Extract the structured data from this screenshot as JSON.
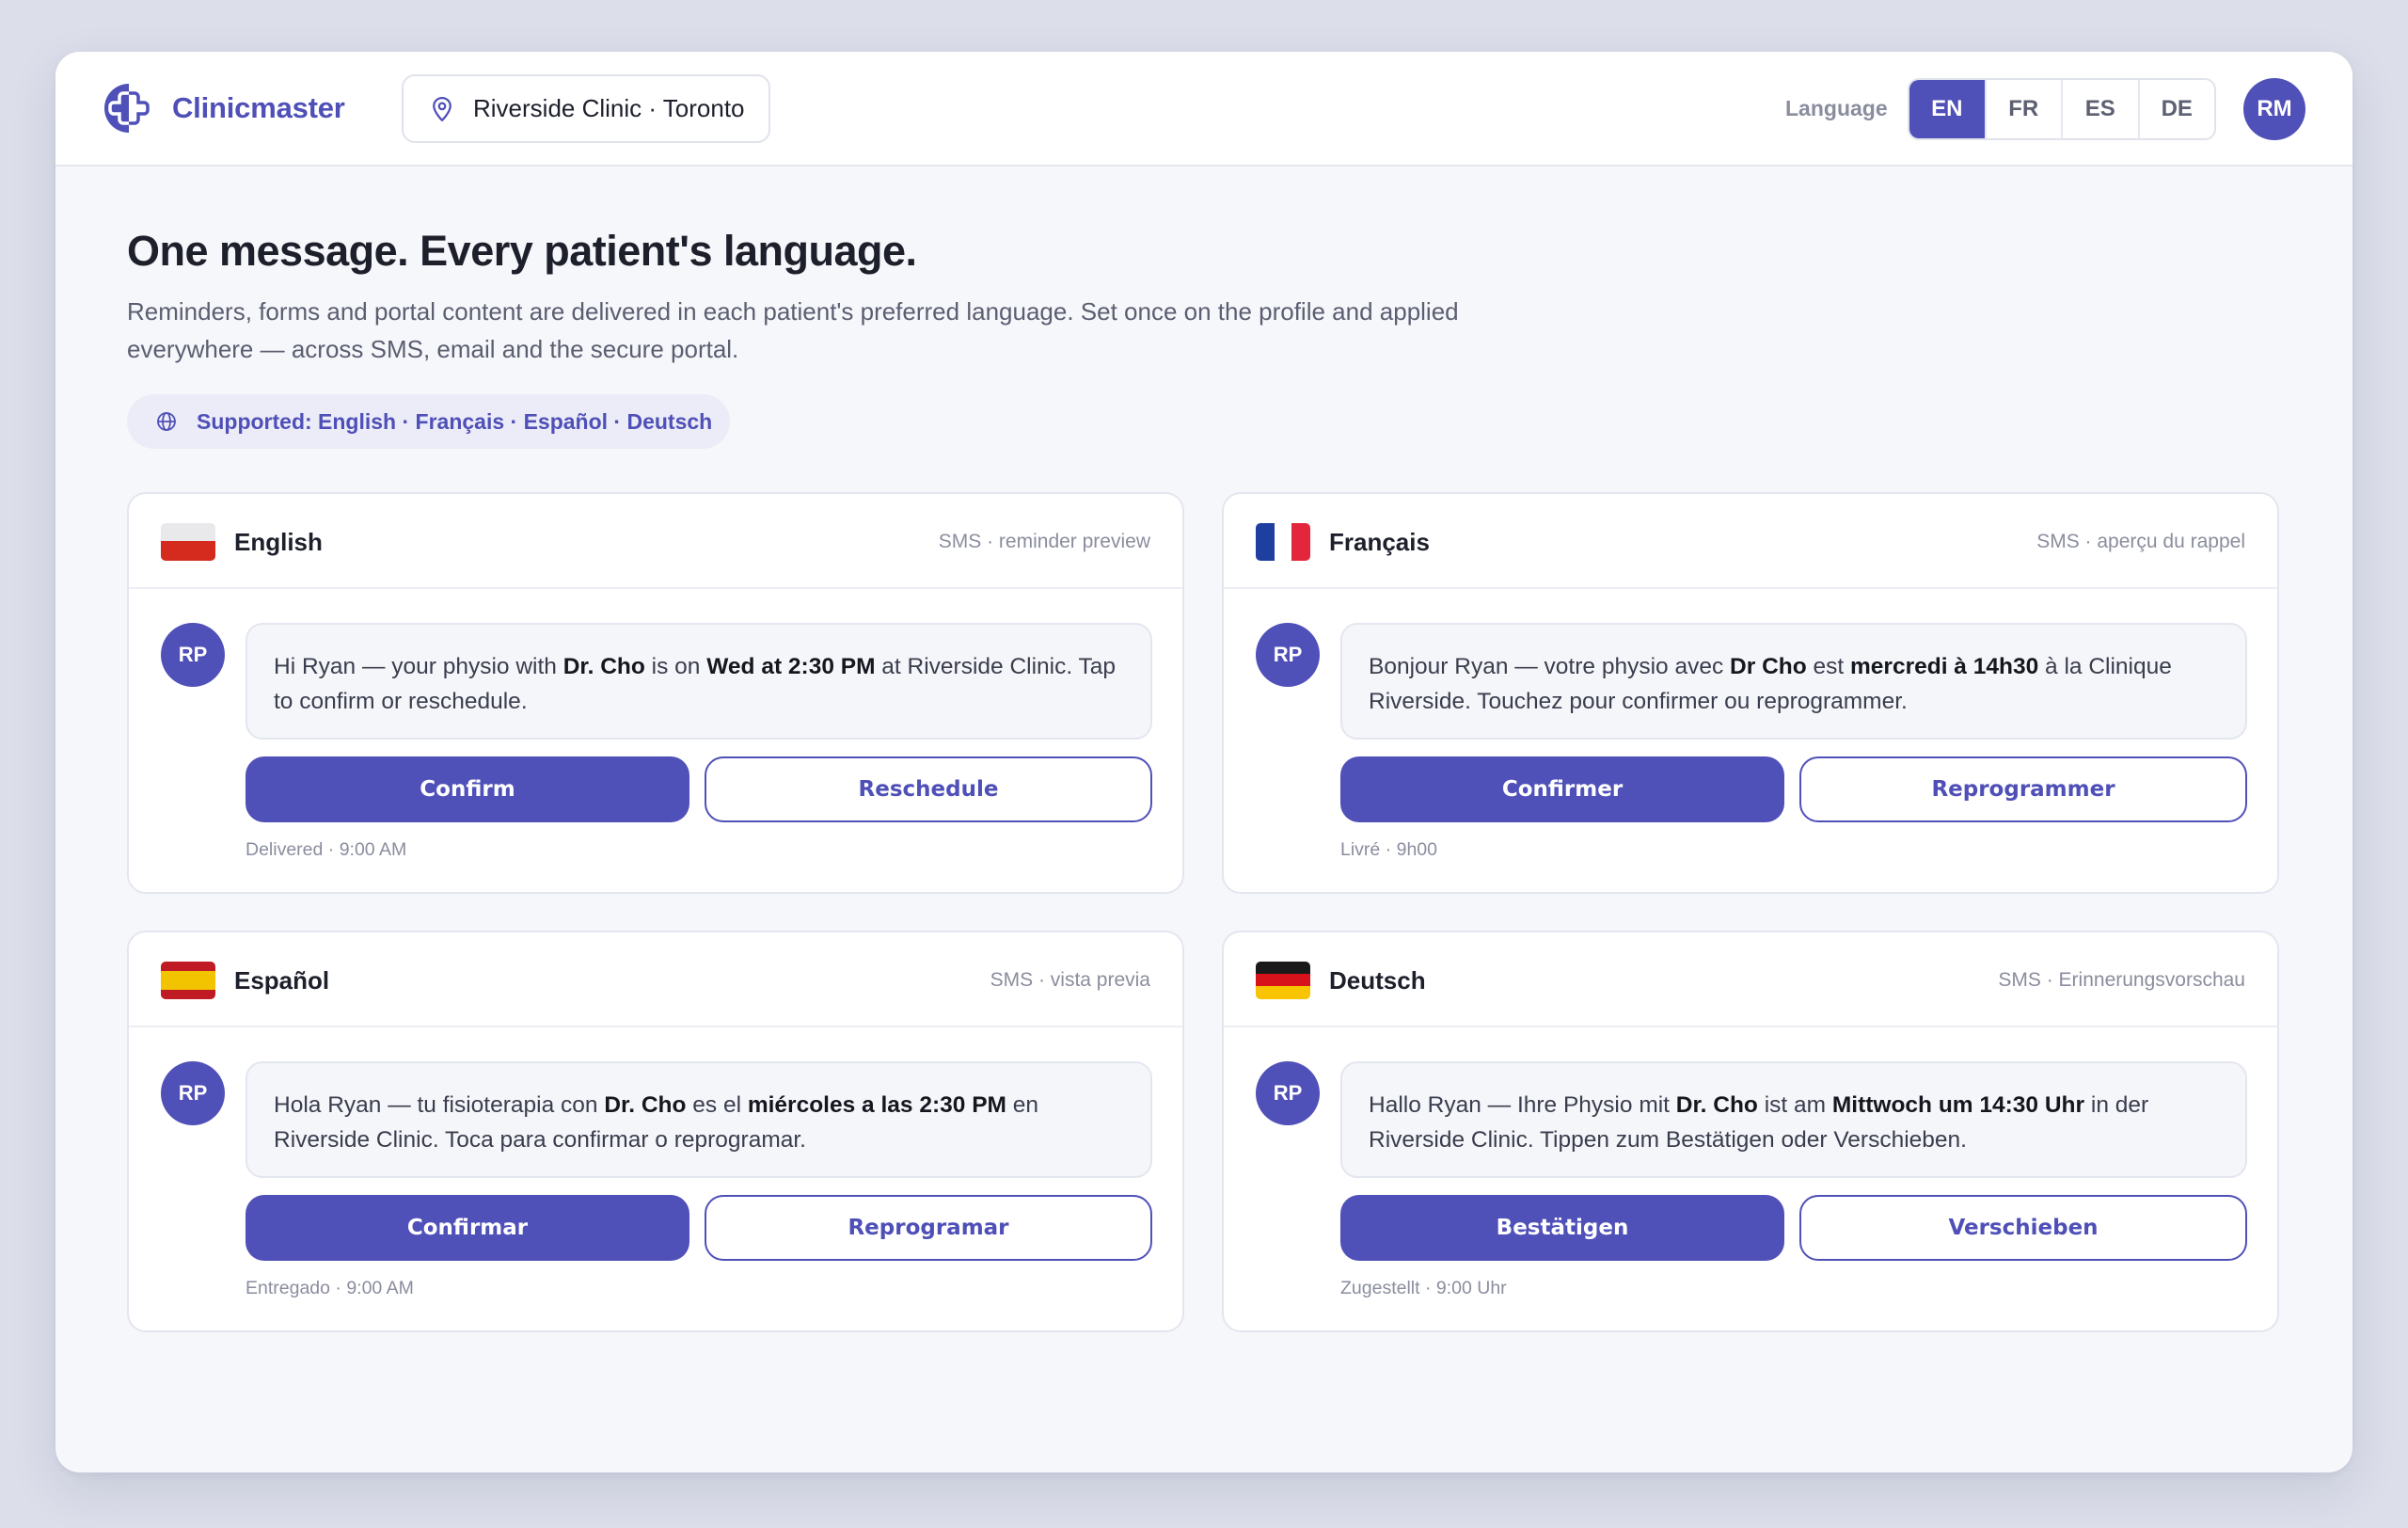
{
  "header": {
    "brand": "Clinicmaster",
    "location": "Riverside Clinic · Toronto",
    "language_label": "Language",
    "languages": [
      "EN",
      "FR",
      "ES",
      "DE"
    ],
    "active_language": "EN",
    "user_initials": "RM"
  },
  "intro": {
    "title": "One message. Every patient's language.",
    "subtitle": "Reminders, forms and portal content are delivered in each patient's preferred language. Set once on the profile and applied everywhere — across SMS, email and the secure portal.",
    "supported": "Supported: English · Français · Español · Deutsch"
  },
  "cards": [
    {
      "language": "English",
      "meta": "SMS · reminder preview",
      "patient_initials": "RP",
      "msg_1": "Hi Ryan — your physio with ",
      "msg_doctor": "Dr. Cho",
      "msg_2": " is on ",
      "msg_time": "Wed at 2:30 PM",
      "msg_3": " at Riverside Clinic. Tap to confirm or reschedule.",
      "confirm": "Confirm",
      "reschedule": "Reschedule",
      "status": "Delivered · 9:00 AM"
    },
    {
      "language": "Français",
      "meta": "SMS · aperçu du rappel",
      "patient_initials": "RP",
      "msg_1": "Bonjour Ryan — votre physio avec ",
      "msg_doctor": "Dr Cho",
      "msg_2": " est ",
      "msg_time": "mercredi à 14h30",
      "msg_3": " à la Clinique Riverside. Touchez pour confirmer ou reprogrammer.",
      "confirm": "Confirmer",
      "reschedule": "Reprogrammer",
      "status": "Livré · 9h00"
    },
    {
      "language": "Español",
      "meta": "SMS · vista previa",
      "patient_initials": "RP",
      "msg_1": "Hola Ryan — tu fisioterapia con ",
      "msg_doctor": "Dr. Cho",
      "msg_2": " es el ",
      "msg_time": "miércoles a las 2:30 PM",
      "msg_3": " en Riverside Clinic. Toca para confirmar o reprogramar.",
      "confirm": "Confirmar",
      "reschedule": "Reprogramar",
      "status": "Entregado · 9:00 AM"
    },
    {
      "language": "Deutsch",
      "meta": "SMS · Erinnerungsvorschau",
      "patient_initials": "RP",
      "msg_1": "Hallo Ryan — Ihre Physio mit ",
      "msg_doctor": "Dr. Cho",
      "msg_2": " ist am ",
      "msg_time": "Mittwoch um 14:30 Uhr",
      "msg_3": " in der Riverside Clinic. Tippen zum Bestätigen oder Verschieben.",
      "confirm": "Bestätigen",
      "reschedule": "Verschieben",
      "status": "Zugestellt · 9:00 Uhr"
    }
  ],
  "colors": {
    "accent": "#5050b9",
    "page_bg": "#f6f7fb",
    "outer_bg": "#dcdfea"
  }
}
